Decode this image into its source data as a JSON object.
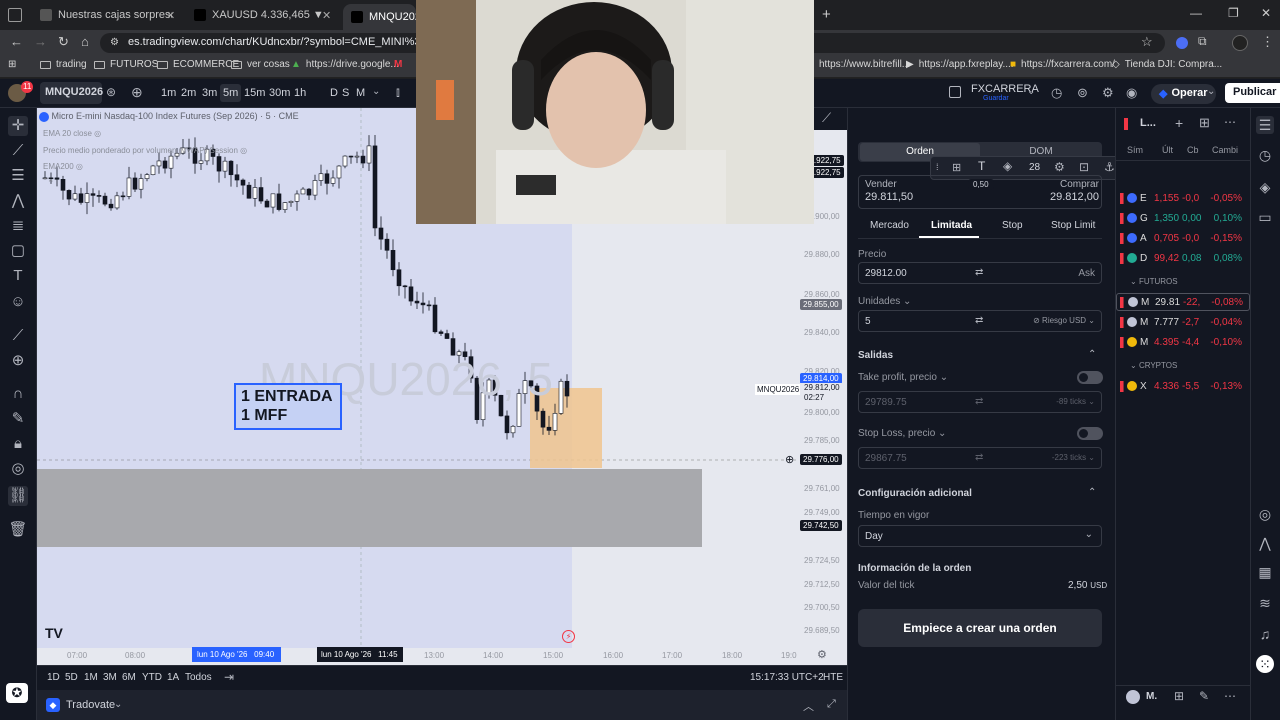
{
  "browser": {
    "tabs": [
      {
        "title": "Nuestras cajas sorpresa – Book"
      },
      {
        "title": "XAUUSD 4.336,465 ▼ −0.13% I"
      },
      {
        "title": "MNQU2026 29"
      }
    ],
    "url": "es.tradingview.com/chart/KUdncxbr/?symbol=CME_MINI%3AMNQU2",
    "bookmarks": [
      "trading",
      "FUTUROS",
      "ECOMMERCE",
      "ver cosas",
      "https://drive.google...",
      "https://www.bitrefill...",
      "https://app.fxreplay....",
      "https://fxcarrera.com/",
      "Tienda DJI: Compra..."
    ],
    "notification_count": "11"
  },
  "header": {
    "symbol": "MNQU2026",
    "intervals": [
      "1m",
      "2m",
      "3m",
      "5m",
      "15m",
      "30m",
      "1h",
      "D",
      "S",
      "M"
    ],
    "selected_interval": "5m",
    "layout_name": "FXCARRERA",
    "layout_status": "Guardar",
    "operate_label": "Operar",
    "publish_label": "Publicar"
  },
  "chart": {
    "legend_title": "Micro E-mini Nasdaq-100 Index Futures (Sep 2026) · 5 · CME",
    "indicators": [
      "EMA 20 close",
      "Precio medio ponderado por volumen (VWAP) Session",
      "EMA200"
    ],
    "watermark": "MNQU2026, 5",
    "annotation_line1": "1 ENTRADA",
    "annotation_line2": "1 MFF",
    "price_axis": [
      "29.922,75",
      "29.900,00",
      "29.880,00",
      "29.860,00",
      "29.855,00",
      "29.840,00",
      "29.820,00",
      "29.814,00",
      "29.812,00",
      "29.800,00",
      "29.785,00",
      "29.776,00",
      "29.761,00",
      "29.749,00",
      "29.742,50",
      "29.724,50",
      "29.712,50",
      "29.700,50",
      "29.689,50"
    ],
    "current_price_label": "MNQU2026",
    "current_price": "29.812,00",
    "countdown": "02:27",
    "cross_price": "29.776,00",
    "zone_price": "29.742,50",
    "high_label": "29.855,00",
    "last_marker": "29.814,00",
    "time_axis": [
      "07:00",
      "08:00",
      "11:00",
      "13:00",
      "14:00",
      "15:00",
      "16:00",
      "17:00",
      "18:00",
      "19:0"
    ],
    "time_marker_1": "lun 10 Ago '26   09:40",
    "time_marker_2": "lun 10 Ago '26   11:45",
    "top_price": "29.922,75"
  },
  "bottombar": {
    "ranges": [
      "1D",
      "5D",
      "1M",
      "3M",
      "6M",
      "YTD",
      "1A",
      "Todos"
    ],
    "clock": "15:17:33 UTC+2",
    "session": "HTE"
  },
  "broker": {
    "name": "Tradovate"
  },
  "order_panel": {
    "tab_order": "Orden",
    "tab_dom": "DOM",
    "font_size": "28",
    "tooltip_value": "0,50",
    "sell_label": "Vender",
    "sell_price": "29.811,50",
    "buy_label": "Comprar",
    "buy_price": "29.812,00",
    "order_types": [
      "Mercado",
      "Limitada",
      "Stop",
      "Stop Limit"
    ],
    "selected_type": "Limitada",
    "price_label": "Precio",
    "price_value": "29812.00",
    "price_suffix": "Ask",
    "units_label": "Unidades",
    "units_value": "5",
    "risk_label": "Riesgo USD",
    "exits_label": "Salidas",
    "tp_label": "Take profit, precio",
    "tp_value": "29789.75",
    "tp_ticks": "-89 ticks",
    "sl_label": "Stop Loss, precio",
    "sl_value": "29867.75",
    "sl_ticks": "-223 ticks",
    "extra_config": "Configuración adicional",
    "tif_label": "Tiempo en vigor",
    "tif_value": "Day",
    "order_info": "Información de la orden",
    "tick_value_label": "Valor del tick",
    "tick_value": "2,50",
    "tick_currency": "USD",
    "create_button": "Empiece a crear una orden"
  },
  "watchlist": {
    "title": "L...",
    "columns": [
      "Sím",
      "Últ",
      "Cb",
      "Cambi"
    ],
    "rows": [
      {
        "sym": "E",
        "last": "1,155",
        "chg": "-0,0",
        "pct": "-0,05%",
        "dir": "neg"
      },
      {
        "sym": "G",
        "last": "1,350",
        "chg": "0,00",
        "pct": "0,10%",
        "dir": "pos"
      },
      {
        "sym": "A",
        "last": "0,705",
        "chg": "-0,0",
        "pct": "-0,15%",
        "dir": "neg"
      },
      {
        "sym": "D",
        "last": "99,42",
        "chg": "0,08",
        "pct": "0,08%",
        "dir": "pos"
      }
    ],
    "futures_label": "FUTUROS",
    "futures": [
      {
        "sym": "M",
        "last": "29.81",
        "chg": "-22,",
        "pct": "-0,08%",
        "dir": "neg"
      },
      {
        "sym": "M",
        "last": "7.777",
        "chg": "-2,7",
        "pct": "-0,04%",
        "dir": "neg"
      },
      {
        "sym": "M",
        "last": "4.395",
        "chg": "-4,4",
        "pct": "-0,10%",
        "dir": "neg"
      }
    ],
    "crypto_label": "CRYPTOS",
    "crypto": [
      {
        "sym": "X",
        "last": "4.336",
        "chg": "-5,5",
        "pct": "-0,13%",
        "dir": "neg"
      }
    ],
    "footer_symbol": "M."
  },
  "colors": {
    "accent": "#2962ff",
    "down": "#f23645",
    "up": "#22ab94",
    "entry_zone": "#f0c48e",
    "gray_zone": "#a8a9ad"
  }
}
